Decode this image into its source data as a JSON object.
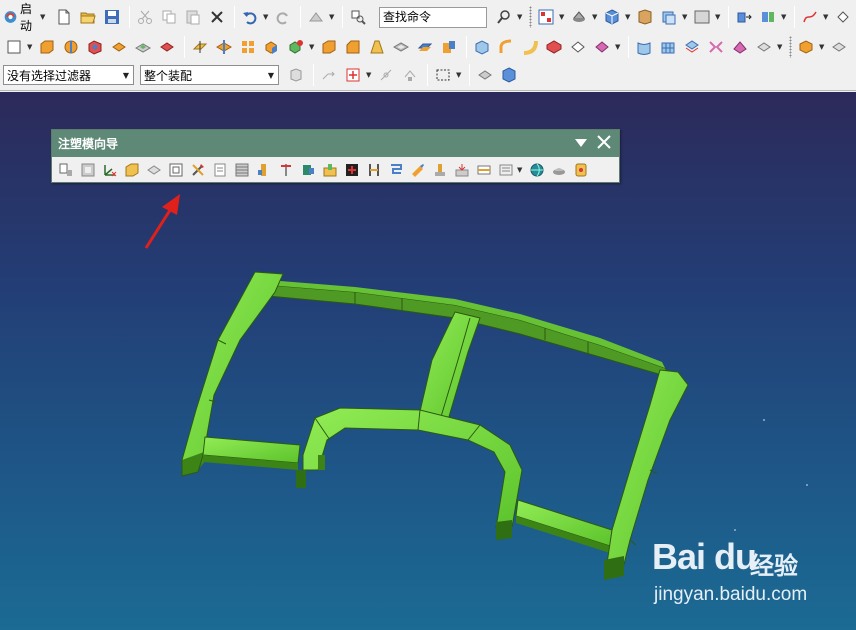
{
  "toolbar": {
    "start_label": "启动",
    "command_search": "查找命令"
  },
  "selection_bar": {
    "filter_value": "没有选择过滤器",
    "scope_value": "整个装配"
  },
  "molding_wizard": {
    "title": "注塑模向导"
  },
  "watermark": {
    "brand": "Bai du",
    "brand_suffix": "经验",
    "url": "jingyan.baidu.com"
  },
  "colors": {
    "title_bar": "#5e8977",
    "model_green": "#6ad13a",
    "arrow_red": "#e0201a"
  }
}
